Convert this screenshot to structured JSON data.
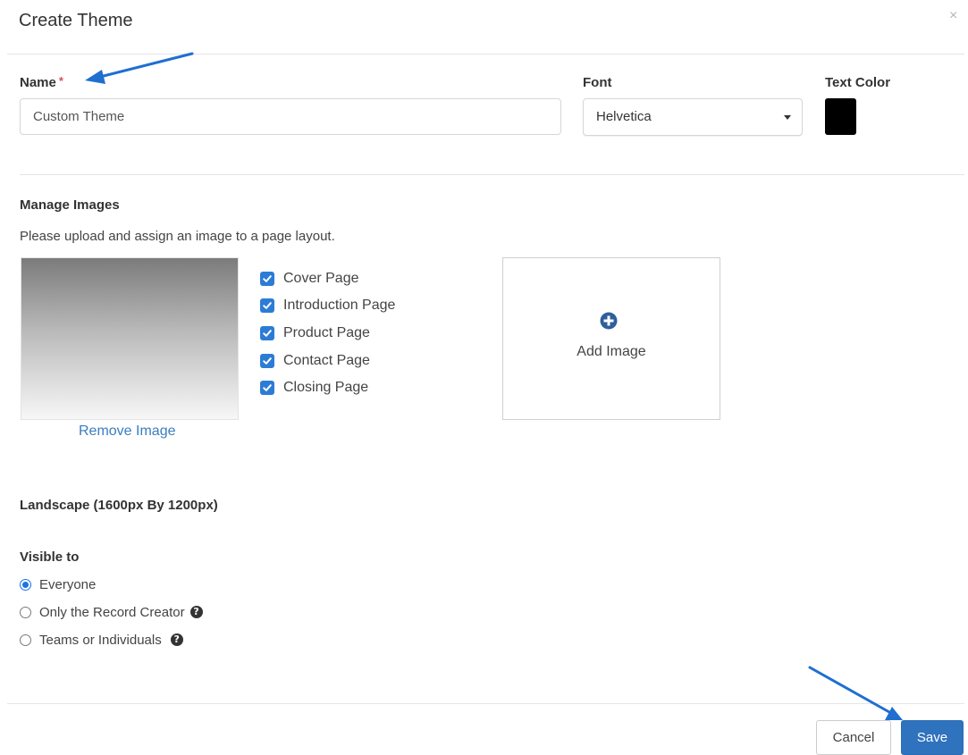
{
  "dialog": {
    "title": "Create Theme",
    "close_glyph": "×"
  },
  "name_field": {
    "label": "Name",
    "required_mark": "*",
    "value": "Custom Theme"
  },
  "font_field": {
    "label": "Font",
    "selected": "Helvetica"
  },
  "text_color": {
    "label": "Text Color",
    "value": "#000000"
  },
  "images": {
    "heading": "Manage Images",
    "instructions": "Please upload and assign an image to a page layout.",
    "remove_label": "Remove Image",
    "add_label": "Add Image",
    "add_icon": "plus-circle-icon",
    "pages": [
      {
        "label": "Cover Page",
        "checked": true
      },
      {
        "label": "Introduction Page",
        "checked": true
      },
      {
        "label": "Product Page",
        "checked": true
      },
      {
        "label": "Contact Page",
        "checked": true
      },
      {
        "label": "Closing Page",
        "checked": true
      }
    ]
  },
  "layout_text": "Landscape (1600px By 1200px)",
  "visibility": {
    "label": "Visible to",
    "options": [
      {
        "label": "Everyone",
        "checked": true
      },
      {
        "label": "Only the Record Creator",
        "checked": false,
        "help_icon": "question-circle-icon"
      },
      {
        "label": "Teams or Individuals",
        "checked": false,
        "help_icon": "question-circle-icon"
      }
    ]
  },
  "footer": {
    "cancel_label": "Cancel",
    "save_label": "Save"
  },
  "colors": {
    "accent": "#2f72bd",
    "checkbox": "#2c7cd6",
    "link": "#3a7dbf",
    "required": "#d9534f",
    "annotation_arrow": "#1f6fd0"
  }
}
